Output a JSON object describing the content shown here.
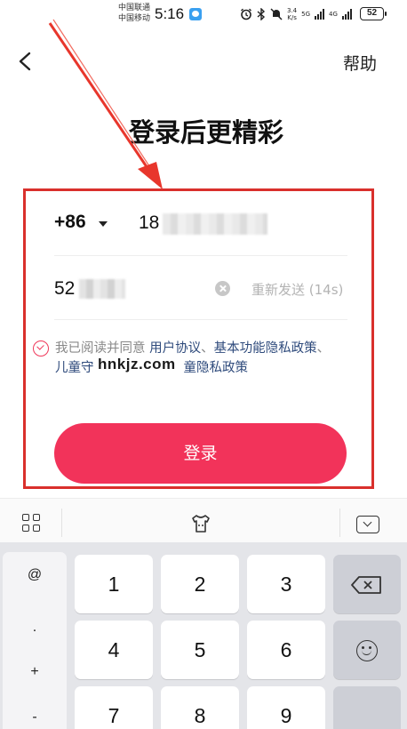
{
  "status_bar": {
    "carrier_1": "中国联通",
    "carrier_2": "中国移动",
    "time": "5:16",
    "network_speed_value": "3.4",
    "network_speed_unit": "K/s",
    "sim1_network": "5G",
    "sim2_network": "4G",
    "battery": "52"
  },
  "header": {
    "help_label": "帮助",
    "title": "登录后更精彩"
  },
  "form": {
    "country_code": "+86",
    "phone_prefix": "18",
    "code_prefix": "52",
    "resend_label": "重新发送 (14s)",
    "agreement": {
      "prefix": "我已阅读并同意 ",
      "link_user": "用户协议",
      "sep1": "、",
      "link_privacy": "基本功能隐私政策",
      "sep2": "、",
      "link_child_1": "儿童守",
      "link_child_2": "童隐私政策"
    },
    "watermark": "hnkjz.com",
    "login_label": "登录"
  },
  "keyboard": {
    "symbols": [
      "@",
      ".",
      "+",
      "-"
    ],
    "rows": [
      [
        "1",
        "2",
        "3"
      ],
      [
        "4",
        "5",
        "6"
      ],
      [
        "7",
        "8",
        "9"
      ]
    ]
  },
  "colors": {
    "accent": "#f2335a",
    "annotation": "#d9302c",
    "link": "#2f4b7c"
  }
}
